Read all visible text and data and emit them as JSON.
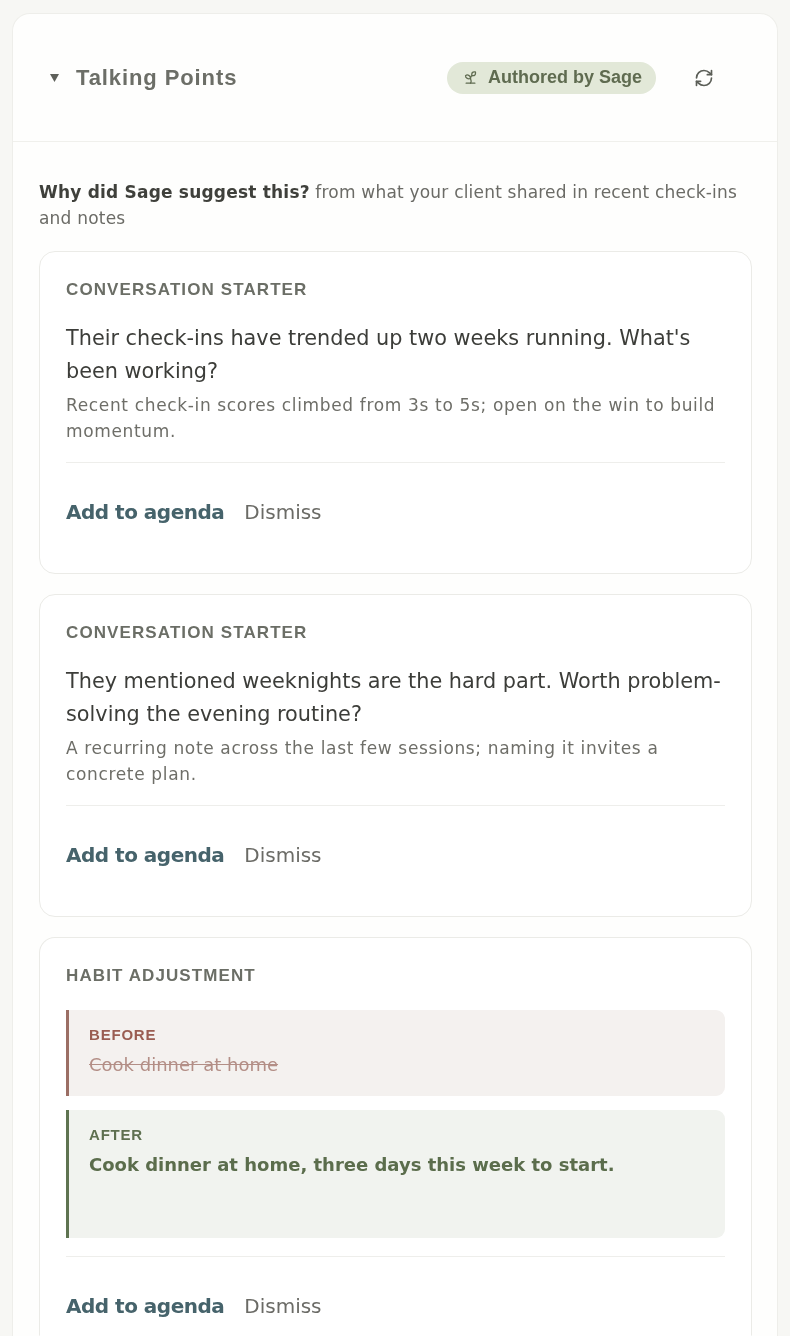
{
  "panel": {
    "title": "Talking Points",
    "expanded": true,
    "badge": "Authored by Sage"
  },
  "intro": "**Why did Sage suggest this?** from what your client shared in recent check-ins and notes",
  "cards": [
    {
      "kind": "starter",
      "label": "CONVERSATION STARTER",
      "prompt": "Their check-ins have trended up two weeks running. What's been working?",
      "note": "Recent check-in scores climbed from 3s to 5s; open on the win to build momentum.",
      "actions": [
        {
          "kind": "primary",
          "label": "Add to agenda"
        },
        {
          "kind": "secondary",
          "label": "Dismiss"
        }
      ]
    },
    {
      "kind": "starter",
      "label": "CONVERSATION STARTER",
      "prompt": "They mentioned weeknights are the hard part. Worth problem-solving the evening routine?",
      "note": "A recurring note across the last few sessions; naming it invites a concrete plan.",
      "actions": [
        {
          "kind": "primary",
          "label": "Add to agenda"
        },
        {
          "kind": "secondary",
          "label": "Dismiss"
        }
      ]
    },
    {
      "kind": "habit",
      "label": "HABIT ADJUSTMENT",
      "changes": [
        {
          "kind": "before",
          "label": "BEFORE",
          "text": "Cook dinner at home"
        },
        {
          "kind": "after",
          "label": "AFTER",
          "text": "Cook dinner at home, three days this week to start."
        }
      ],
      "actions": [
        {
          "kind": "primary",
          "label": "Add to agenda"
        },
        {
          "kind": "secondary",
          "label": "Dismiss"
        }
      ]
    }
  ]
}
